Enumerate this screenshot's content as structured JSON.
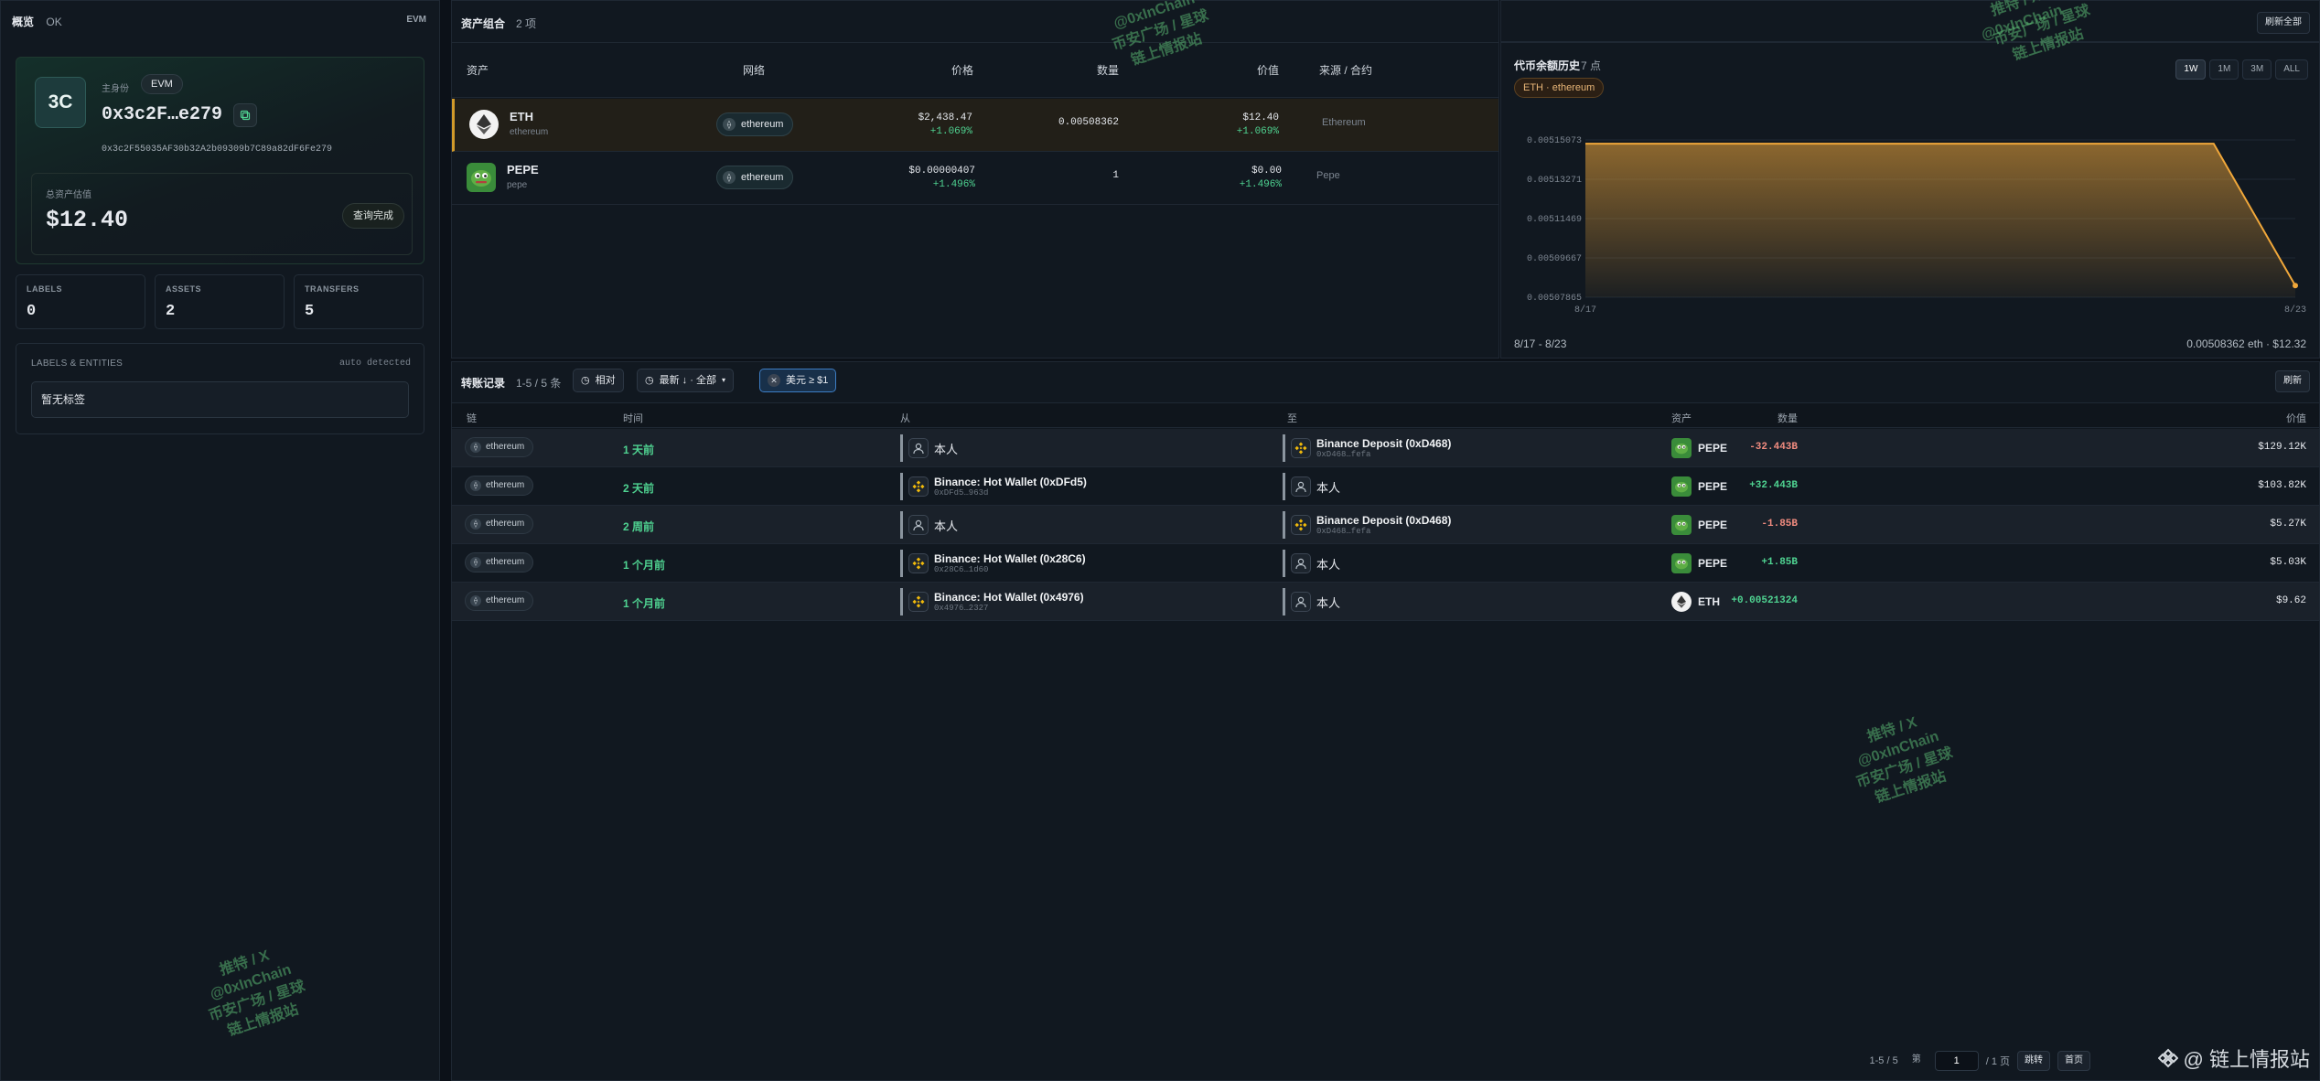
{
  "header": {
    "title": "概览",
    "status": "OK",
    "chain_type": "EVM"
  },
  "identity": {
    "avatar_text": "3C",
    "role_label": "主身份",
    "tag": "EVM",
    "short_address": "0x3c2F…e279",
    "full_address": "0x3c2F55035AF30b32A2b09309b7C89a82dF6Fe279",
    "value_label": "总资产估值",
    "total_value": "$12.40",
    "query_button": "查询完成"
  },
  "stats": [
    {
      "label": "LABELS",
      "value": "0"
    },
    {
      "label": "ASSETS",
      "value": "2"
    },
    {
      "label": "TRANSFERS",
      "value": "5"
    }
  ],
  "entities": {
    "title": "LABELS & ENTITIES",
    "note": "auto detected",
    "empty": "暂无标签"
  },
  "portfolio": {
    "title": "资产组合",
    "count": "2 项",
    "columns": {
      "asset": "资产",
      "network": "网络",
      "price": "价格",
      "quantity": "数量",
      "value": "价值",
      "source": "来源 / 合约"
    },
    "rows": [
      {
        "symbol": "ETH",
        "name": "ethereum",
        "network": "ethereum",
        "price": "$2,438.47",
        "price_change": "+1.069%",
        "quantity": "0.00508362",
        "value": "$12.40",
        "value_change": "+1.069%",
        "source": "Ethereum",
        "icon": "eth-icon",
        "color": "#627eea"
      },
      {
        "symbol": "PEPE",
        "name": "pepe",
        "network": "ethereum",
        "price": "$0.00000407",
        "price_change": "+1.496%",
        "quantity": "1",
        "value": "$0.00",
        "value_change": "+1.496%",
        "source": "Pepe",
        "icon": "pepe-icon",
        "color": "#3a8c3a"
      }
    ]
  },
  "history": {
    "title": "代币余额历史",
    "points_count": "7 点",
    "tag": "ETH · ethereum",
    "ranges": [
      "1W",
      "1M",
      "3M",
      "ALL"
    ],
    "active_range": "1W",
    "refresh_all": "刷新全部",
    "date_range": "8/17 - 8/23",
    "summary": "0.00508362 eth · $12.32"
  },
  "chart_data": {
    "type": "area",
    "x": [
      "8/17",
      "8/18",
      "8/19",
      "8/20",
      "8/21",
      "8/22",
      "8/23"
    ],
    "series": [
      {
        "values": [
          0.005149,
          0.005149,
          0.005149,
          0.005149,
          0.005149,
          0.005149,
          0.005084
        ]
      }
    ],
    "x_tick_labels": [
      "8/17",
      "8/23"
    ],
    "y_tick_labels": [
      "0.00515073",
      "0.00513271",
      "0.00511469",
      "0.00509667",
      "0.00507865"
    ],
    "ylim": [
      0.00507865,
      0.00515073
    ],
    "grid": true,
    "line_color": "#f0a73a"
  },
  "transfers": {
    "title": "转账记录",
    "count": "1-5 / 5 条",
    "filters": [
      {
        "label": "相对",
        "icon": "clock-icon"
      },
      {
        "label": "最新 ↓ · 全部",
        "icon": "clock-icon"
      },
      {
        "label": "美元 ≥ $1",
        "icon": "close-icon",
        "active": true
      }
    ],
    "refresh": "刷新",
    "columns": {
      "chain": "链",
      "time": "时间",
      "from": "从",
      "to": "至",
      "asset": "资产",
      "amount": "数量",
      "value": "价值"
    },
    "rows": [
      {
        "chain": "ethereum",
        "time": "1 天前",
        "from_name": "本人",
        "from_addr": "",
        "from_type": "self",
        "to_name": "Binance Deposit (0xD468)",
        "to_addr": "0xD468…fefa",
        "to_type": "binance",
        "asset": "PEPE",
        "asset_type": "pepe",
        "amount": "-32.443B",
        "amount_sign": "neg",
        "usd": "$129.12K"
      },
      {
        "chain": "ethereum",
        "time": "2 天前",
        "from_name": "Binance: Hot Wallet (0xDFd5)",
        "from_addr": "0xDFd5…963d",
        "from_type": "binance",
        "to_name": "本人",
        "to_addr": "",
        "to_type": "self",
        "asset": "PEPE",
        "asset_type": "pepe",
        "amount": "+32.443B",
        "amount_sign": "pos",
        "usd": "$103.82K"
      },
      {
        "chain": "ethereum",
        "time": "2 周前",
        "from_name": "本人",
        "from_addr": "",
        "from_type": "self",
        "to_name": "Binance Deposit (0xD468)",
        "to_addr": "0xD468…fefa",
        "to_type": "binance",
        "asset": "PEPE",
        "asset_type": "pepe",
        "amount": "-1.85B",
        "amount_sign": "neg",
        "usd": "$5.27K"
      },
      {
        "chain": "ethereum",
        "time": "1 个月前",
        "from_name": "Binance: Hot Wallet (0x28C6)",
        "from_addr": "0x28C6…1d60",
        "from_type": "binance",
        "to_name": "本人",
        "to_addr": "",
        "to_type": "self",
        "asset": "PEPE",
        "asset_type": "pepe",
        "amount": "+1.85B",
        "amount_sign": "pos",
        "usd": "$5.03K"
      },
      {
        "chain": "ethereum",
        "time": "1 个月前",
        "from_name": "Binance: Hot Wallet (0x4976)",
        "from_addr": "0x4976…2327",
        "from_type": "binance",
        "to_name": "本人",
        "to_addr": "",
        "to_type": "self",
        "asset": "ETH",
        "asset_type": "eth",
        "amount": "+0.00521324",
        "amount_sign": "pos",
        "usd": "$9.62"
      }
    ],
    "pager": {
      "range": "1-5 / 5",
      "page_prefix": "第",
      "page": "1",
      "page_suffix": "/ 1 页",
      "jump": "跳转",
      "first": "首页"
    }
  },
  "watermarks": [
    {
      "line1": "推特 / X",
      "line2": "@0xInChain",
      "line3": "币安广场 / 星球",
      "line4": "链上情报站"
    }
  ],
  "brand": {
    "text": "@ 链上情报站"
  }
}
